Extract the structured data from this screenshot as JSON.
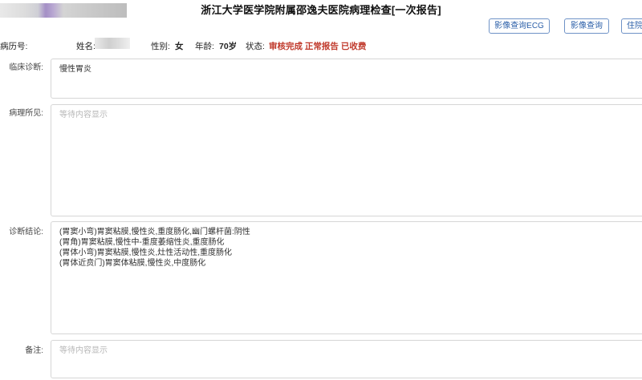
{
  "report": {
    "title": "浙江大学医学院附属邵逸夫医院病理检查[一次报告]"
  },
  "toolbar": {
    "ecg_label": "影像查询ECG",
    "image_label": "影像查询",
    "third_label": "住院"
  },
  "patient": {
    "record_label": "病历号:",
    "name_label": "姓名:",
    "gender_label": "性别:",
    "gender_value": "女",
    "age_label": "年龄:",
    "age_value": "70岁",
    "status_label": "状态:",
    "status_value": "审核完成 正常报告 已收费"
  },
  "sections": {
    "clinical": {
      "label": "临床诊断:",
      "text": "慢性胃炎"
    },
    "findings": {
      "label": "病理所见:",
      "placeholder": "等待内容显示"
    },
    "conclusion": {
      "label": "诊断结论:",
      "lines": [
        "(胃窦小弯)胃窦粘膜,慢性炎,重度肠化,幽门螺杆菌:阴性",
        "(胃角)胃窦粘膜,慢性中-重度萎缩性炎,重度肠化",
        "(胃体小弯)胃窦粘膜,慢性炎,灶性活动性,重度肠化",
        "(胃体近贲门)胃窦体粘膜,慢性炎,中度肠化"
      ]
    },
    "remarks": {
      "label": "备注:",
      "placeholder": "等待内容显示"
    }
  },
  "colors": {
    "accent": "#2b5fa8",
    "status": "#c0392b"
  }
}
